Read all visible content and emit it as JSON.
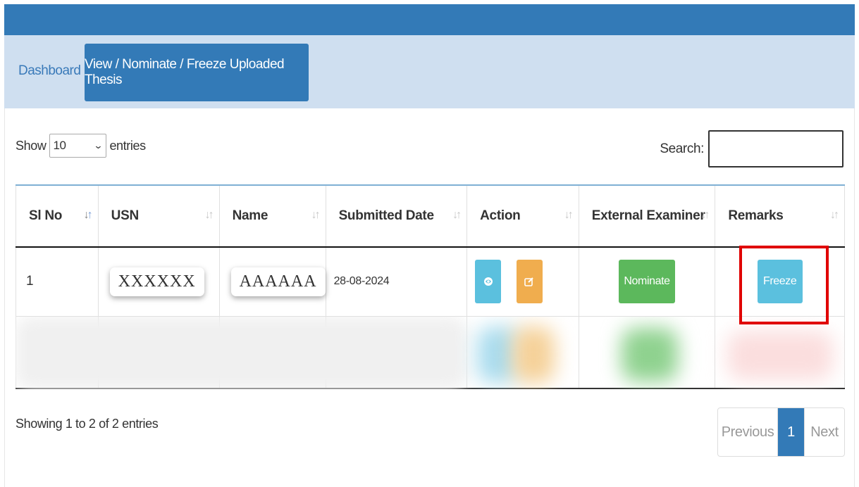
{
  "tabs": {
    "dashboard": "Dashboard",
    "active": "View / Nominate / Freeze Uploaded Thesis"
  },
  "length": {
    "show": "Show",
    "value": "10",
    "entries": "entries"
  },
  "search": {
    "label": "Search:"
  },
  "table": {
    "headers": [
      "Sl No",
      "USN",
      "Name",
      "Submitted Date",
      "Action",
      "External Examiner",
      "Remarks"
    ],
    "row1": {
      "sl": "1",
      "usn": "XXXXXX",
      "name": "AAAAAA",
      "date": "28-08-2024",
      "nominate": "Nominate",
      "freeze": "Freeze"
    }
  },
  "footer": {
    "info": "Showing 1 to 2 of 2 entries",
    "previous": "Previous",
    "page": "1",
    "next": "Next"
  },
  "colors": {
    "primary": "#337ab7",
    "info": "#5bc0de",
    "warning": "#f0ad4e",
    "success": "#5cb85c",
    "highlight": "#e00000"
  }
}
